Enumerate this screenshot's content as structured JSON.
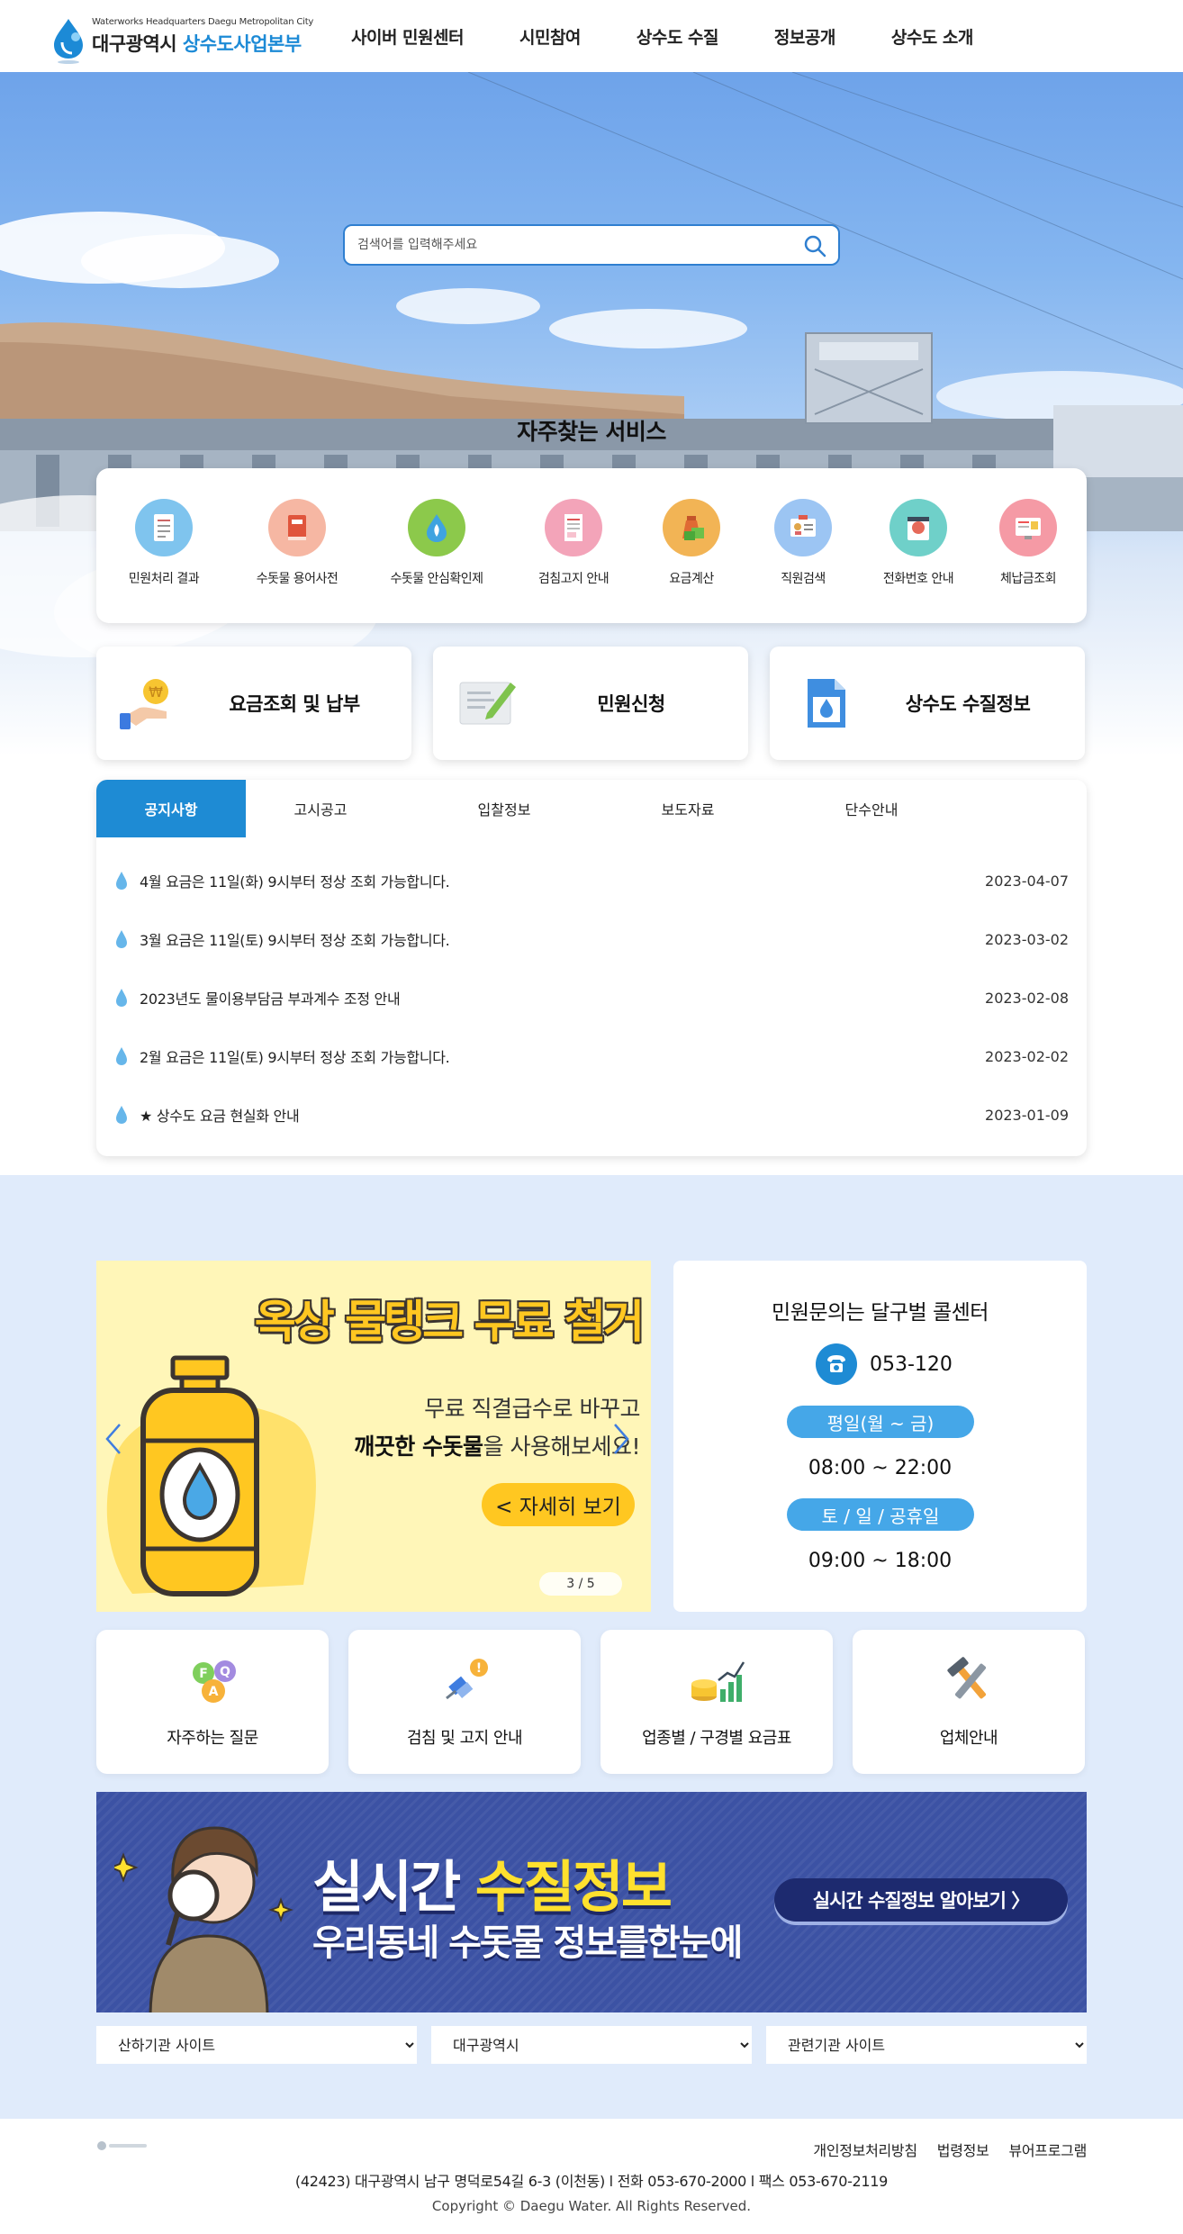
{
  "header": {
    "logo_small": "Waterworks Headquarters Daegu Metropolitan City",
    "logo_city": "대구광역시",
    "logo_org": "상수도사업본부",
    "nav": [
      "사이버 민원센터",
      "시민참여",
      "상수도 수질",
      "정보공개",
      "상수도 소개"
    ]
  },
  "search": {
    "placeholder": "검색어를 입력해주세요",
    "icon": "search-icon"
  },
  "frequent": {
    "title": "자주찾는 서비스",
    "items": [
      {
        "label": "민원처리 결과",
        "icon": "document-list-icon",
        "color": "#7fc4ee"
      },
      {
        "label": "수돗물 용어사전",
        "icon": "book-icon",
        "color": "#f6b7a3"
      },
      {
        "label": "수돗물 안심확인제",
        "icon": "water-leaf-icon",
        "color": "#8cc94b"
      },
      {
        "label": "검침고지 안내",
        "icon": "receipt-icon",
        "color": "#f3a4b9"
      },
      {
        "label": "요금계산",
        "icon": "money-bag-icon",
        "color": "#f2b455"
      },
      {
        "label": "직원검색",
        "icon": "id-card-icon",
        "color": "#9cc5f3"
      },
      {
        "label": "전화번호 안내",
        "icon": "phone-book-icon",
        "color": "#6fd0c9"
      },
      {
        "label": "체납금조회",
        "icon": "monitor-won-icon",
        "color": "#f59aa5"
      }
    ]
  },
  "quick": [
    {
      "label": "요금조회 및 납부",
      "icon": "coin-hand-icon"
    },
    {
      "label": "민원신청",
      "icon": "pencil-form-icon"
    },
    {
      "label": "상수도 수질정보",
      "icon": "water-document-icon"
    }
  ],
  "notice": {
    "tabs": [
      "공지사항",
      "고시공고",
      "입찰정보",
      "보도자료",
      "단수안내"
    ],
    "active_tab": "공지사항",
    "items": [
      {
        "title": "4월 요금은 11일(화) 9시부터 정상 조회 가능합니다.",
        "date": "2023-04-07"
      },
      {
        "title": "3월 요금은 11일(토) 9시부터 정상 조회 가능합니다.",
        "date": "2023-03-02"
      },
      {
        "title": "2023년도 물이용부담금 부과계수 조정 안내",
        "date": "2023-02-08"
      },
      {
        "title": "2월 요금은 11일(토) 9시부터 정상 조회 가능합니다.",
        "date": "2023-02-02"
      },
      {
        "title": "★ 상수도 요금 현실화 안내",
        "date": "2023-01-09"
      }
    ]
  },
  "promo": {
    "title": "옥상 물탱크 무료 철거",
    "line1": "무료 직결급수로 바꾸고",
    "line2_bold": "깨끗한 수돗물",
    "line2_rest": "을 사용해보세요!",
    "button": "<  자세히 보기",
    "pager": "3  /  5"
  },
  "callcenter": {
    "title": "민원문의는 달구벌 콜센터",
    "phone": "053-120",
    "weekday_label": "평일(월 ~ 금)",
    "weekday_hours": "08:00 ~ 22:00",
    "weekend_label": "토 / 일 / 공휴일",
    "weekend_hours": "09:00 ~ 18:00"
  },
  "quicklinks": [
    {
      "label": "자주하는 질문",
      "icon": "faq-bubbles-icon"
    },
    {
      "label": "검침 및 고지 안내",
      "icon": "satellite-alert-icon"
    },
    {
      "label": "업종별 / 구경별 요금표",
      "icon": "coins-chart-icon"
    },
    {
      "label": "업체안내",
      "icon": "hammer-wrench-icon"
    }
  ],
  "banner": {
    "title_white": "실시간 ",
    "title_yellow": "수질정보",
    "subtitle": "우리동네 수돗물 정보를한눈에",
    "button": "실시간 수질정보 알아보기 〉"
  },
  "selects": [
    "산하기관 사이트",
    "대구광역시",
    "관련기관 사이트"
  ],
  "footer": {
    "links": [
      "개인정보처리방침",
      "법령정보",
      "뷰어프로그램"
    ],
    "address": "(42423) 대구광역시 남구 명덕로54길 6-3 (이천동) l 전화 053-670-2000 l 팩스 053-670-2119",
    "copyright": "Copyright © Daegu Water. All Rights Reserved."
  }
}
